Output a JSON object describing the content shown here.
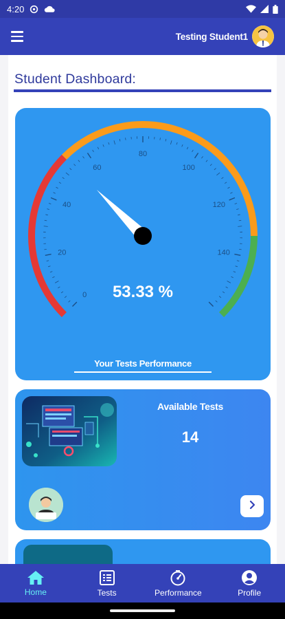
{
  "status_bar": {
    "time": "4:20",
    "icons": [
      "settings-gear-icon",
      "cloud-icon",
      "wifi-icon",
      "signal-icon",
      "battery-icon"
    ]
  },
  "app_bar": {
    "user_name": "Testing Student1",
    "menu_icon": "hamburger-menu-icon"
  },
  "dashboard": {
    "title": "Student Dashboard:"
  },
  "gauge": {
    "value": 53.33,
    "value_text": "53.33 %",
    "min": 0,
    "max": 160,
    "tick_labels": [
      "0",
      "20",
      "40",
      "60",
      "80",
      "100",
      "120",
      "140"
    ],
    "caption": "Your Tests Performance",
    "colors": {
      "low": "#e53935",
      "mid": "#fb9b1b",
      "high": "#4caf50",
      "card": "#2f97f0",
      "needle": "#ffffff",
      "hub": "#000000"
    }
  },
  "available_tests": {
    "label": "Available Tests",
    "count": "14",
    "arrow_icon": "chevron-right-icon"
  },
  "bottom_nav": {
    "items": [
      {
        "label": "Home",
        "icon": "home-icon",
        "active": true
      },
      {
        "label": "Tests",
        "icon": "list-icon",
        "active": false
      },
      {
        "label": "Performance",
        "icon": "speedometer-icon",
        "active": false
      },
      {
        "label": "Profile",
        "icon": "person-icon",
        "active": false
      }
    ],
    "active_color": "#66f0f4"
  },
  "theme": {
    "primary": "#3442b8",
    "accent": "#2f97f0"
  }
}
